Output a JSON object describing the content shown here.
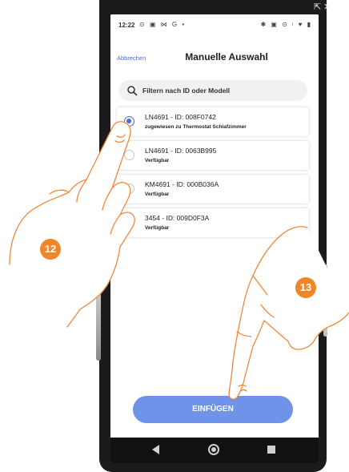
{
  "status": {
    "time": "12:22",
    "left_icons": "⊙ ▣ ⋈ G •",
    "right_icons": "✱ ▣ ⊙ ᵎ ♥ ▮"
  },
  "window_controls": "⇱ ✕",
  "header": {
    "cancel_label": "Abbrechen",
    "title": "Manuelle Auswahl"
  },
  "search": {
    "placeholder": "Filtern nach ID oder Modell",
    "icon": "search-icon"
  },
  "devices": [
    {
      "title": "LN4691 - ID: 008F0742",
      "status": "zugewiesen zu Thermostat Schlafzimmer",
      "selected": true
    },
    {
      "title": "LN4691 - ID: 0063B995",
      "status": "Verfügbar",
      "selected": false
    },
    {
      "title": "KM4691 - ID: 000B036A",
      "status": "Verfügbar",
      "selected": false
    },
    {
      "title": "3454 - ID: 009D0F3A",
      "status": "Verfügbar",
      "selected": false
    }
  ],
  "insert_button": {
    "label": "EINFÜGEN"
  },
  "steps": {
    "first": "12",
    "second": "13"
  },
  "colors": {
    "accent": "#4a6bd8",
    "button": "#6f93e8",
    "marker": "#f08529"
  }
}
